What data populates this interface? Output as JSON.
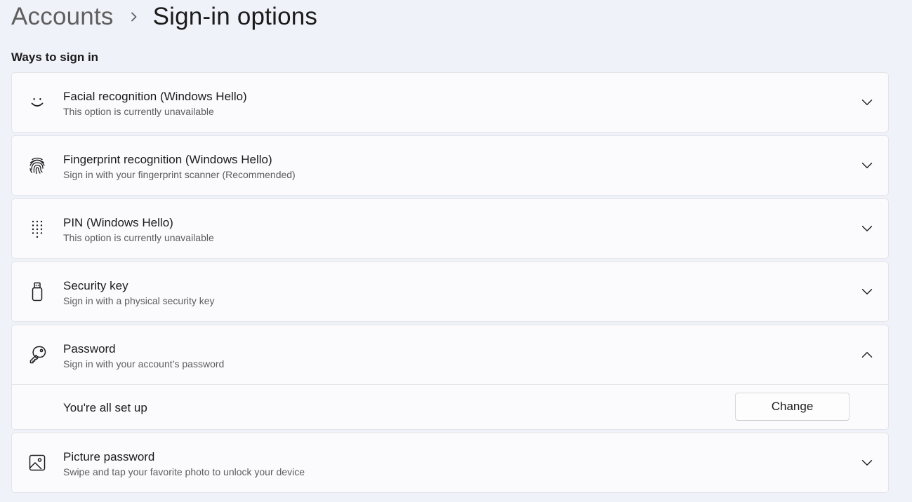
{
  "breadcrumb": {
    "parent": "Accounts",
    "separator_icon": "chevron-right-icon",
    "current": "Sign-in options"
  },
  "section": {
    "title": "Ways to sign in"
  },
  "options": [
    {
      "icon": "face-smile-icon",
      "title": "Facial recognition (Windows Hello)",
      "subtitle": "This option is currently unavailable",
      "expanded": false
    },
    {
      "icon": "fingerprint-icon",
      "title": "Fingerprint recognition (Windows Hello)",
      "subtitle": "Sign in with your fingerprint scanner (Recommended)",
      "expanded": false
    },
    {
      "icon": "pin-keypad-icon",
      "title": "PIN (Windows Hello)",
      "subtitle": "This option is currently unavailable",
      "expanded": false
    },
    {
      "icon": "security-key-icon",
      "title": "Security key",
      "subtitle": "Sign in with a physical security key",
      "expanded": false
    },
    {
      "icon": "key-icon",
      "title": "Password",
      "subtitle": "Sign in with your account’s password",
      "expanded": true,
      "detail": {
        "status": "You're all set up",
        "button_label": "Change"
      }
    },
    {
      "icon": "picture-icon",
      "title": "Picture password",
      "subtitle": "Swipe and tap your favorite photo to unlock your device",
      "expanded": false
    }
  ],
  "colors": {
    "background": "#f0f2f9",
    "card": "#fbfbfd",
    "border": "#e3e4e8",
    "text": "#1b1b1b",
    "secondary_text": "#5d5d5d"
  }
}
